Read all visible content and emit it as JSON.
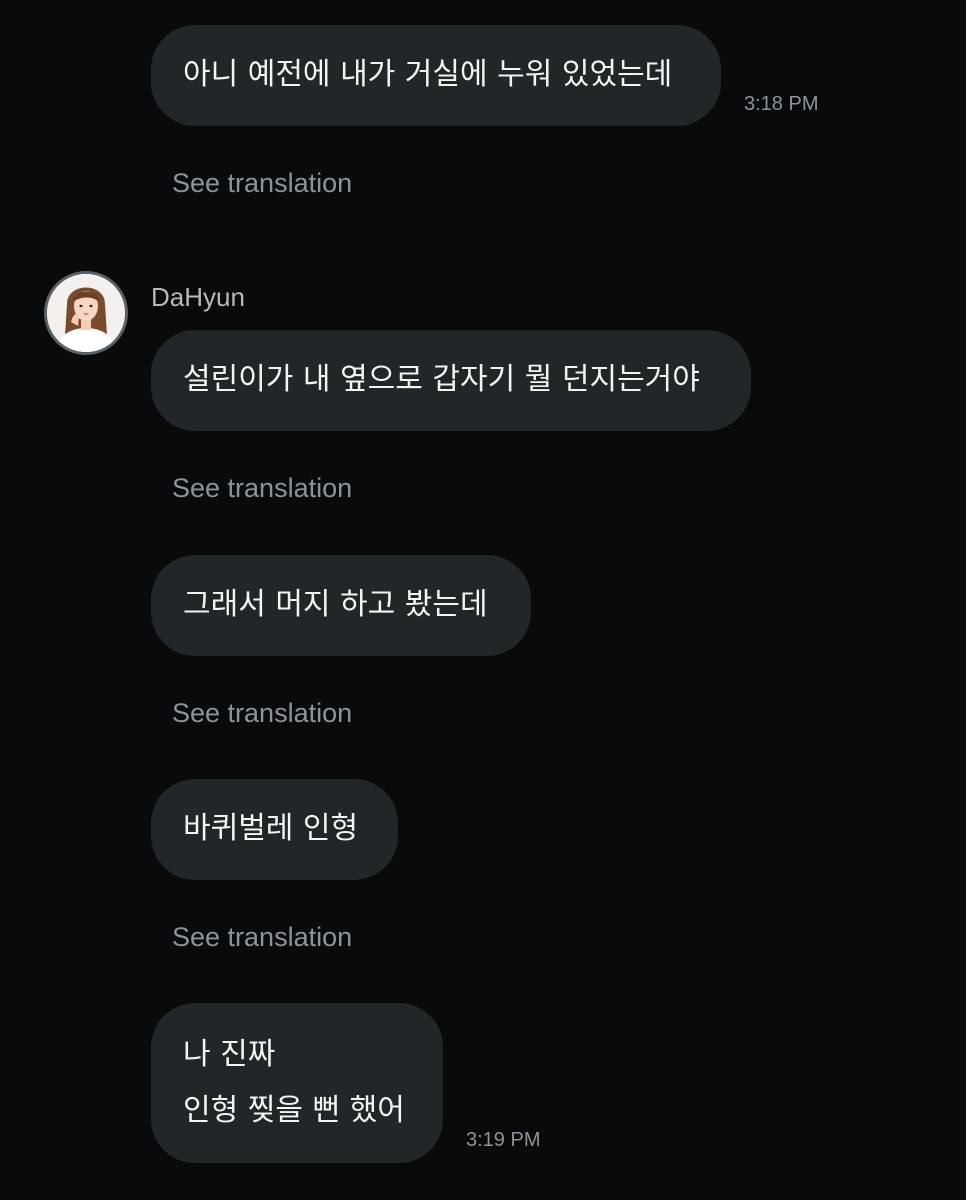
{
  "conversation": {
    "messages": [
      {
        "lines": [
          "아니 예전에 내가 거실에 누워 있었는데"
        ],
        "time": "3:18 PM",
        "see_translation": "See translation"
      },
      {
        "sender": "DaHyun",
        "lines": [
          "설린이가 내 옆으로 갑자기 뭘 던지는거야"
        ],
        "see_translation": "See translation"
      },
      {
        "lines": [
          "그래서 머지 하고 봤는데"
        ],
        "see_translation": "See translation"
      },
      {
        "lines": [
          "바퀴벌레 인형"
        ],
        "see_translation": "See translation"
      },
      {
        "lines": [
          "나 진짜",
          "인형 찢을 뻔 했어"
        ],
        "time": "3:19 PM"
      }
    ]
  },
  "colors": {
    "background": "#090a0c",
    "bubble": "#212629",
    "muted_text": "#8b949b",
    "message_text": "#f2f4f5"
  },
  "icons": {
    "avatar": "profile-photo"
  }
}
